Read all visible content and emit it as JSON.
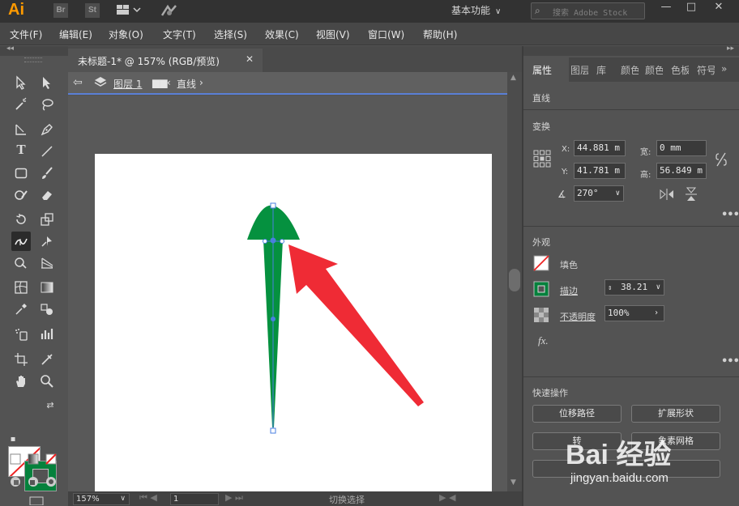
{
  "titlebar": {
    "app_logo": "Ai",
    "bridge": "Br",
    "stock": "St",
    "workspace": "基本功能",
    "search_placeholder": "搜索 Adobe Stock"
  },
  "menu": [
    "文件(F)",
    "编辑(E)",
    "对象(O)",
    "文字(T)",
    "选择(S)",
    "效果(C)",
    "视图(V)",
    "窗口(W)",
    "帮助(H)"
  ],
  "document": {
    "tab_title": "未标题-1* @ 157% (RGB/预览)",
    "breadcrumb_layer": "图层 1",
    "breadcrumb_object": "直线"
  },
  "statusbar": {
    "zoom": "157%",
    "artboard": "1",
    "mode_text": "切换选择"
  },
  "properties": {
    "tabs": [
      "属性",
      "图层",
      "库",
      "颜色",
      "颜色",
      "色板",
      "符号"
    ],
    "object_type": "直线",
    "transform_title": "变换",
    "x_label": "X:",
    "x_value": "44.881 m",
    "y_label": "Y:",
    "y_value": "41.781 m",
    "w_label": "宽:",
    "w_value": "0 mm",
    "h_label": "高:",
    "h_value": "56.849 m",
    "angle_value": "270°",
    "appearance_title": "外观",
    "fill_label": "填色",
    "stroke_label": "描边",
    "stroke_value": "38.21",
    "opacity_label": "不透明度",
    "opacity_value": "100%",
    "fx_label": "fx.",
    "quick_title": "快速操作",
    "btn_offset": "位移路径",
    "btn_expand": "扩展形状",
    "btn_hidden_left": "转",
    "btn_hidden_right": "象素网格"
  },
  "colors": {
    "shape_green": "#05913f",
    "arrow_red": "#ef2b35",
    "selection_blue": "#4a7fe0",
    "stroke_swatch": "#05813c"
  },
  "watermark": {
    "logo": "Bai 经验",
    "url": "jingyan.baidu.com"
  }
}
